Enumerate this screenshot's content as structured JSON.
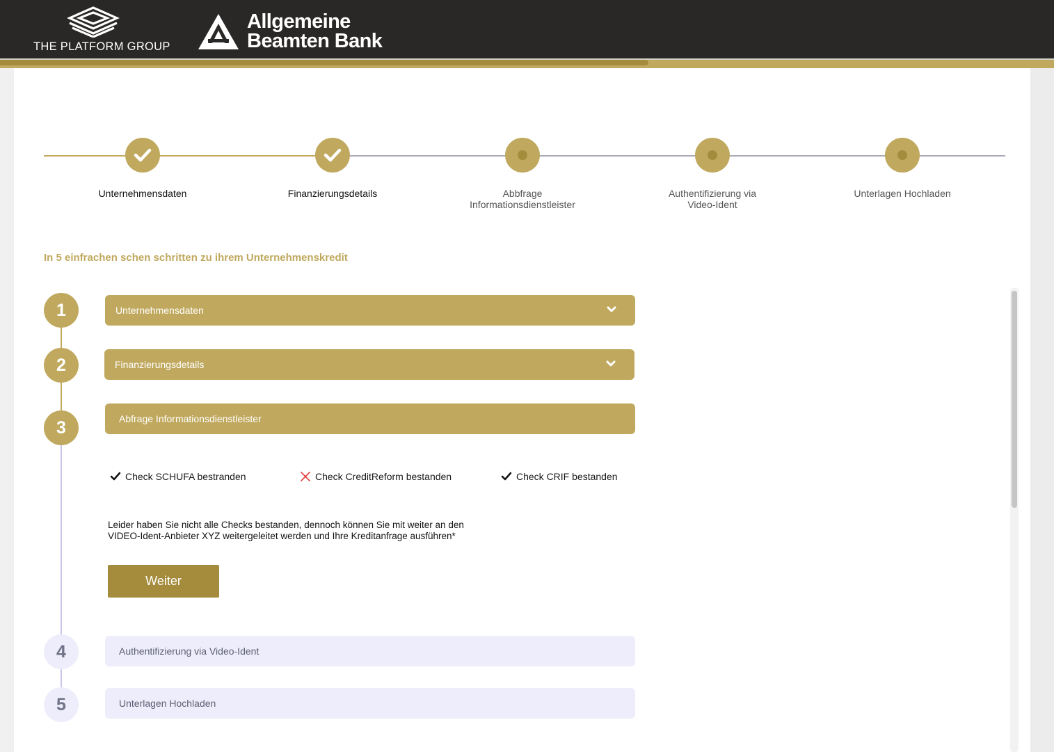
{
  "header": {
    "logo_platform_text": "THE PLATFORM GROUP",
    "logo_bank_line1": "Allgemeine",
    "logo_bank_line2": "Beamten Bank",
    "progress_fraction": 0.615
  },
  "stepper": {
    "steps": [
      {
        "label": "Unternehmensdaten",
        "status": "done"
      },
      {
        "label": "Finanzierungsdetails",
        "status": "done"
      },
      {
        "label": "Abbfrage\nInformationsdienstleister",
        "status": "current"
      },
      {
        "label": "Authentifizierung via\nVideo-Ident",
        "status": "pending"
      },
      {
        "label": "Unterlagen Hochladen",
        "status": "pending"
      }
    ]
  },
  "intro": "In 5 einfrachen schen schritten zu ihrem Unternehmenskredit",
  "sections": [
    {
      "number": "1",
      "title": "Unternehmensdaten",
      "state": "done"
    },
    {
      "number": "2",
      "title": "Finanzierungsdetails",
      "state": "done"
    },
    {
      "number": "3",
      "title": "Abfrage Informationsdienstleister",
      "state": "open"
    },
    {
      "number": "4",
      "title": "Authentifizierung via Video-Ident",
      "state": "pending"
    },
    {
      "number": "5",
      "title": "Unterlagen Hochladen",
      "state": "pending"
    }
  ],
  "checks": [
    {
      "label": "Check SCHUFA bestranden",
      "result": "pass"
    },
    {
      "label": "Check CreditReform bestanden",
      "result": "fail"
    },
    {
      "label": "Check CRIF bestanden",
      "result": "pass"
    }
  ],
  "message_line1": "Leider haben Sie nicht alle Checks bestanden, dennoch können Sie mit weiter an den",
  "message_line2": "VIDEO-Ident-Anbieter XYZ weitergeleitet werden und Ihre Kreditanfrage ausführen*",
  "continue_label": "Weiter",
  "colors": {
    "gold": "#c0a95e",
    "gold_dark": "#a58c3d",
    "header_bg": "#2a2826",
    "lavender": "#eeedfb",
    "fail_red": "#e0403a"
  }
}
